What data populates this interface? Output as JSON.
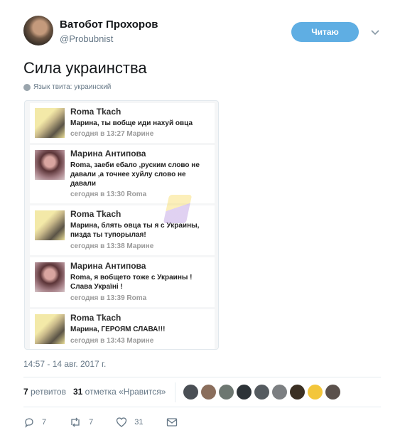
{
  "header": {
    "display_name": "Ватобот Прохоров",
    "username": "@Probubnist",
    "follow_label": "Читаю"
  },
  "tweet": {
    "text": "Сила украинства",
    "language_note": "Язык твита: украинский",
    "timestamp": "14:57 - 14 авг. 2017 г."
  },
  "messages": [
    {
      "name": "Roma Tkach",
      "text": "Марина, ты вобще иди нахуй овца",
      "time": "сегодня в 13:27 Марине"
    },
    {
      "name": "Марина Антипова",
      "text": "Roma, заеби ебало ,руским слово не давали ,а точнее хуйлу слово не давали",
      "time": "сегодня в 13:30 Roma"
    },
    {
      "name": "Roma Tkach",
      "text": "Марина, блять овца ты я с Украины, пизда ты тупорылая!",
      "time": "сегодня в 13:38 Марине"
    },
    {
      "name": "Марина Антипова",
      "text": "Roma, я вобщето тоже с Украины !Слава Україні !",
      "time": "сегодня в 13:39 Roma"
    },
    {
      "name": "Roma Tkach",
      "text": "Марина, ГЕРОЯМ СЛАВА!!!",
      "time": "сегодня в 13:43 Марине"
    }
  ],
  "stats": {
    "retweets_count": "7",
    "retweets_label": "ретвитов",
    "likes_count": "31",
    "likes_label": "отметка «Нравится»"
  },
  "actions": {
    "reply_count": "7",
    "retweet_count": "7",
    "like_count": "31"
  },
  "icons": [
    "chevron-down-icon",
    "globe-icon",
    "reply-icon",
    "retweet-icon",
    "heart-icon",
    "direct-message-icon"
  ],
  "colors": {
    "accent": "#5faee3",
    "secondary_text": "#657786"
  }
}
